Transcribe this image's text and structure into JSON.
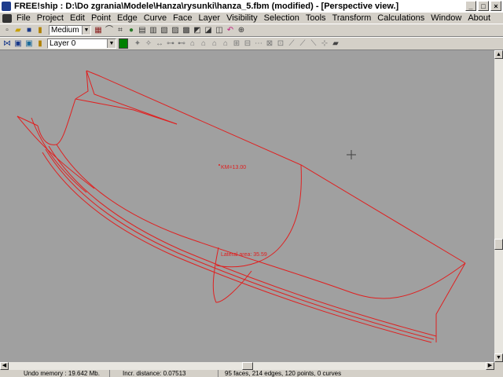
{
  "window": {
    "title": "FREE!ship   : D:\\Do zgrania\\Modele\\Hanza\\rysunki\\hanza_5.fbm (modified) - [Perspective view.]",
    "minimize": "_",
    "maximize": "□",
    "close": "×"
  },
  "menu": [
    "File",
    "Project",
    "Edit",
    "Point",
    "Edge",
    "Curve",
    "Face",
    "Layer",
    "Visibility",
    "Selection",
    "Tools",
    "Transform",
    "Calculations",
    "Window",
    "About"
  ],
  "toolbar": {
    "precision_value": "Medium",
    "layer_value": "Layer 0",
    "layer_color": "#008000"
  },
  "viewport": {
    "background": "#a0a0a0",
    "line_color": "#e02020",
    "label_km": "KM=13.00",
    "label_center": "Lateral area: 35.59"
  },
  "status": {
    "undo": "Undo memory : 19.642 Mb.",
    "incr": "Incr. distance: 0.07513",
    "counts": "95 faces, 214 edges, 120 points, 0 curves"
  }
}
